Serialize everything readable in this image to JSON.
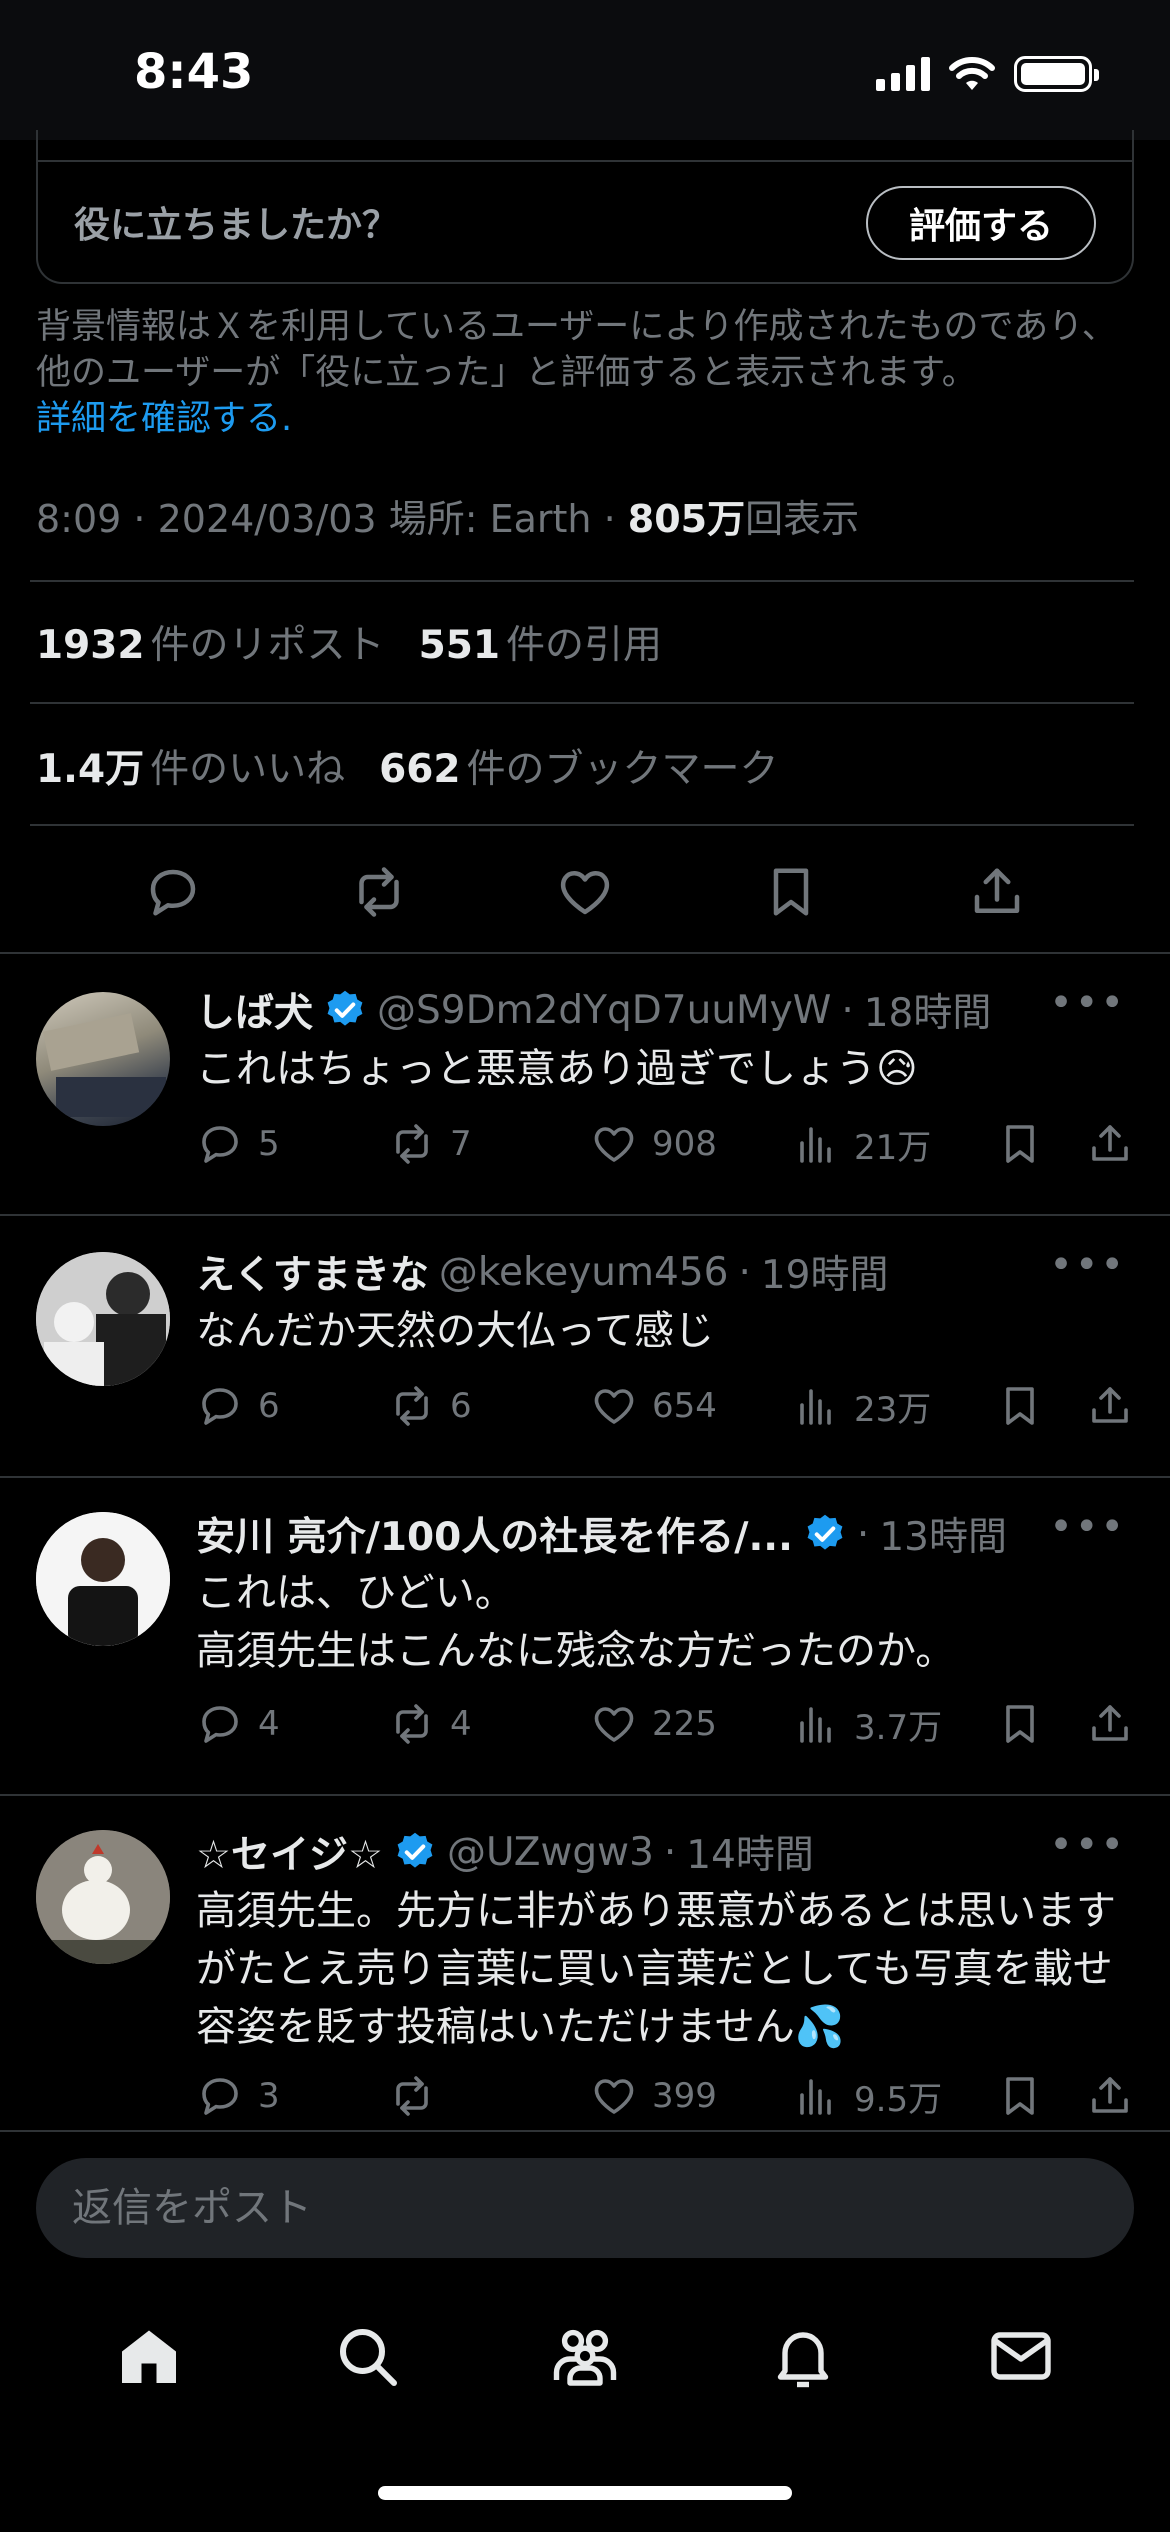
{
  "status_bar": {
    "time": "8:43"
  },
  "note": {
    "question": "役に立ちましたか？",
    "rate_button": "評価する",
    "info": "背景情報はＸを利用しているユーザーにより作成されたものであり、他のユーザーが「役に立った」と評価すると表示されます。",
    "link": "詳細を確認する",
    "link_suffix": "."
  },
  "post_meta": {
    "time": "8:09",
    "date": "2024/03/03",
    "location": "場所: Earth",
    "views_count": "805万",
    "views_label": "回表示"
  },
  "stats": {
    "reposts_count": "1932",
    "reposts_label": "件のリポスト",
    "quotes_count": "551",
    "quotes_label": "件の引用",
    "likes_count": "1.4万",
    "likes_label": "件のいいね",
    "bookmarks_count": "662",
    "bookmarks_label": "件のブックマーク"
  },
  "replies": [
    {
      "name": "しば犬",
      "handle": "@S9Dm2dYqD7uuMyW",
      "time": "18時間",
      "text": "これはちょっと悪意あり過ぎでしょう😥",
      "replies": "5",
      "reposts": "7",
      "likes": "908",
      "views": "21万"
    },
    {
      "name": "えくすまきな",
      "handle": "@kekeyum456",
      "time": "19時間",
      "text": "なんだか天然の大仏って感じ",
      "replies": "6",
      "reposts": "6",
      "likes": "654",
      "views": "23万"
    },
    {
      "name": "安川 亮介/100人の社長を作る/...",
      "handle": "",
      "time": "13時間",
      "text": "これは、ひどい。\n高須先生はこんなに残念な方だったのか。",
      "replies": "4",
      "reposts": "4",
      "likes": "225",
      "views": "3.7万"
    },
    {
      "name": "☆セイジ☆",
      "handle": "@UZwgw3",
      "time": "14時間",
      "text": "高須先生。先方に非があり悪意があるとは思いますがたとえ売り言葉に買い言葉だとしても写真を載せ容姿を貶す投稿はいただけません💦",
      "replies": "3",
      "reposts": "",
      "likes": "399",
      "views": "9.5万"
    }
  ],
  "reply_input": {
    "placeholder": "返信をポスト"
  },
  "colors": {
    "accent": "#1d9bf0",
    "muted": "#71767b",
    "text": "#e7e9ea",
    "border": "#2f3336"
  }
}
